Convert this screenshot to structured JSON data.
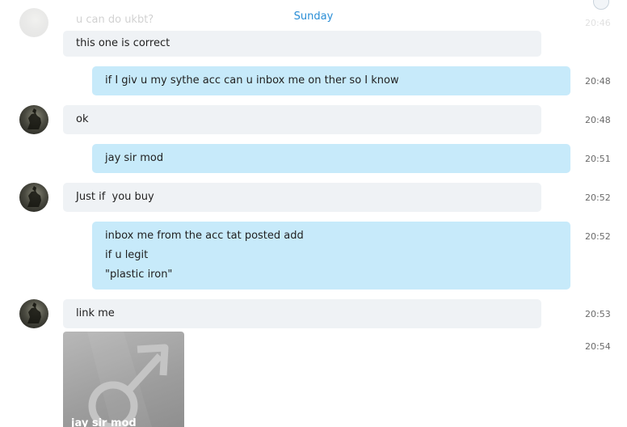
{
  "conversation": {
    "date_divider": "Sunday",
    "faded_message": {
      "text": "u can do ukbt?",
      "time": "20:46"
    },
    "messages": [
      {
        "direction": "in",
        "lines": [
          "this one is correct"
        ]
      },
      {
        "direction": "out",
        "lines": [
          "if I giv u my sythe acc can u inbox me on ther so I know"
        ],
        "time": "20:48"
      },
      {
        "direction": "in",
        "lines": [
          "ok"
        ],
        "time": "20:48"
      },
      {
        "direction": "out",
        "lines": [
          "jay sir mod"
        ],
        "time": "20:51"
      },
      {
        "direction": "in",
        "lines": [
          "Just if  you buy"
        ],
        "time": "20:52"
      },
      {
        "direction": "out",
        "lines": [
          "inbox me from the acc tat posted add",
          "if u legit",
          "\"plastic iron\""
        ],
        "time": "20:52"
      },
      {
        "direction": "in",
        "lines": [
          "link me"
        ],
        "time": "20:53"
      }
    ],
    "image_message": {
      "caption": "jay sir mod",
      "icon": "male-symbol-icon",
      "time": "20:54"
    }
  }
}
